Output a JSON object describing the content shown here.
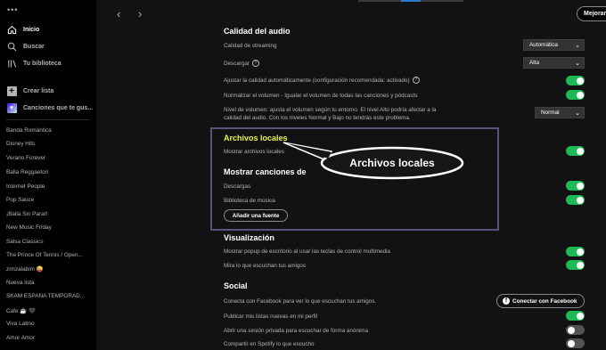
{
  "sidebar": {
    "dots": "•••",
    "nav": [
      {
        "label": "Inicio",
        "icon": "home-icon"
      },
      {
        "label": "Buscar",
        "icon": "search-icon"
      },
      {
        "label": "Tu biblioteca",
        "icon": "library-icon"
      }
    ],
    "actions": [
      {
        "label": "Crear lista",
        "icon": "plus-icon"
      },
      {
        "label": "Canciones que te gus...",
        "icon": "heart-icon"
      }
    ],
    "playlists": [
      "Banda Romántica",
      "Disney Hits",
      "Verano Forever",
      "Balla Reggaeton",
      "Internet People",
      "Pop Sauce",
      "¡Baila Sin Parar!",
      "New Music Friday",
      "Salsa Classics",
      "The Prince Of Tennis / Open...",
      "zimzalabim 😜",
      "Nueva lista",
      "SKAM ESPAÑA TEMPORAD...",
      "Cafe ☕ 🖤",
      "Viva Latino",
      "Amor Amor"
    ]
  },
  "topbar": {
    "back": "‹",
    "forward": "›",
    "upgrade": "Mejorar"
  },
  "settings": {
    "audio": {
      "title": "Calidad del audio",
      "streaming_label": "Calidad de streaming",
      "streaming_value": "Automática",
      "download_label": "Descargar",
      "download_value": "Alta",
      "auto_adjust_label": "Ajustar la calidad automáticamente (configuración recomendada: activado)",
      "normalize_label": "Normalizar el volumen - Igualar el volumen de todas las canciones y pódcasts",
      "volume_level_label_1": "Nivel de volumen: ajusta el volumen según tu entorno. El nivel Alto podría afectar a la",
      "volume_level_label_2": "calidad del audio. Con los niveles Normal y Bajo no tendrás este problema.",
      "volume_level_value": "Normal"
    },
    "local_files": {
      "title": "Archivos locales",
      "show_label": "Mostrar archivos locales",
      "show_songs_title": "Mostrar canciones de",
      "downloads_label": "Descargas",
      "music_library_label": "Biblioteca de música",
      "add_source": "Añadir una fuente"
    },
    "display": {
      "title": "Visualización",
      "popup_label": "Mostrar popup de escritorio al usar las teclas de control multimedia",
      "friends_label": "Mira lo que escuchan tus amigos"
    },
    "social": {
      "title": "Social",
      "facebook_label": "Conecta con Facebook para ver lo que escuchan tus amigos.",
      "facebook_button": "Conectar con Facebook",
      "publish_label": "Publicar mis listas nuevas en mi perfil",
      "private_label": "Abrir una sesión privada para escuchar de forma anónima",
      "share_label": "Compartir en Spotify lo que escucho"
    }
  },
  "annotation": {
    "callout": "Archivos locales"
  },
  "colors": {
    "accent_green": "#1db954",
    "highlight_yellow": "#e8f24a",
    "box_border": "#5a5278"
  }
}
